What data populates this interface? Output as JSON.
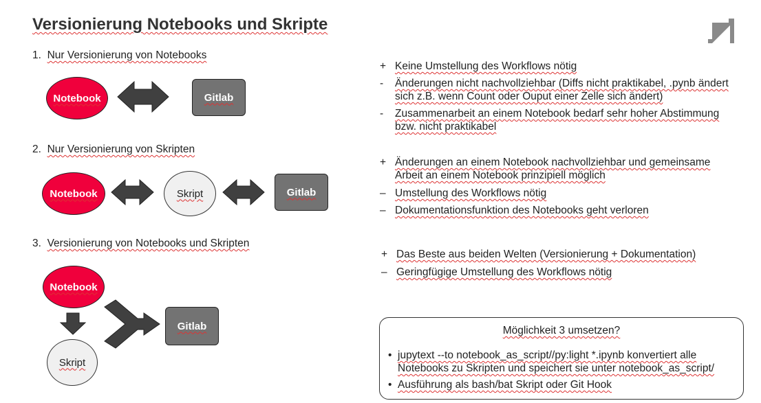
{
  "title": "Versionierung Notebooks und Skripte",
  "sections": [
    {
      "num": "1.",
      "label": "Nur Versionierung von Notebooks"
    },
    {
      "num": "2.",
      "label": "Nur Versionierung von Skripten"
    },
    {
      "num": "3.",
      "label": "Versionierung von Notebooks und Skripten"
    }
  ],
  "nodes": {
    "notebook": "Notebook",
    "gitlab": "Gitlab",
    "skript": "Skript"
  },
  "points1": [
    {
      "sym": "+",
      "text": "Keine Umstellung des Workflows nötig"
    },
    {
      "sym": "-",
      "text": "Änderungen nicht nachvollziehbar (Diffs nicht praktikabel, .pynb ändert sich z.B. wenn Count oder Ouput einer Zelle sich ändert)"
    },
    {
      "sym": "-",
      "text": "Zusammenarbeit an einem Notebook bedarf sehr hoher Abstimmung bzw. nicht praktikabel"
    }
  ],
  "points2": [
    {
      "sym": "+",
      "text": "Änderungen an einem Notebook nachvollziehbar und gemeinsame Arbeit an einem Notebook prinzipiell möglich"
    },
    {
      "sym": "–",
      "text": "Umstellung des Workflows nötig"
    },
    {
      "sym": "–",
      "text": "Dokumentationsfunktion des Notebooks geht verloren"
    }
  ],
  "points3": [
    {
      "sym": "+",
      "text": "Das Beste aus beiden Welten (Versionierung + Dokumentation)"
    },
    {
      "sym": "–",
      "text": "Geringfügige Umstellung des Workflows nötig"
    }
  ],
  "callout": {
    "title": "Möglichkeit 3 umsetzen?",
    "bullets": [
      "jupytext --to notebook_as_script//py:light *.ipynb konvertiert alle Notebooks zu Skripten und speichert sie unter notebook_as_script/",
      "Ausführung als bash/bat Skript oder Git Hook"
    ]
  },
  "colors": {
    "red": "#f0003c",
    "box_grey": "#737373",
    "arrow": "#404040"
  },
  "icons": {
    "logo": "prosieben-logo-icon"
  }
}
